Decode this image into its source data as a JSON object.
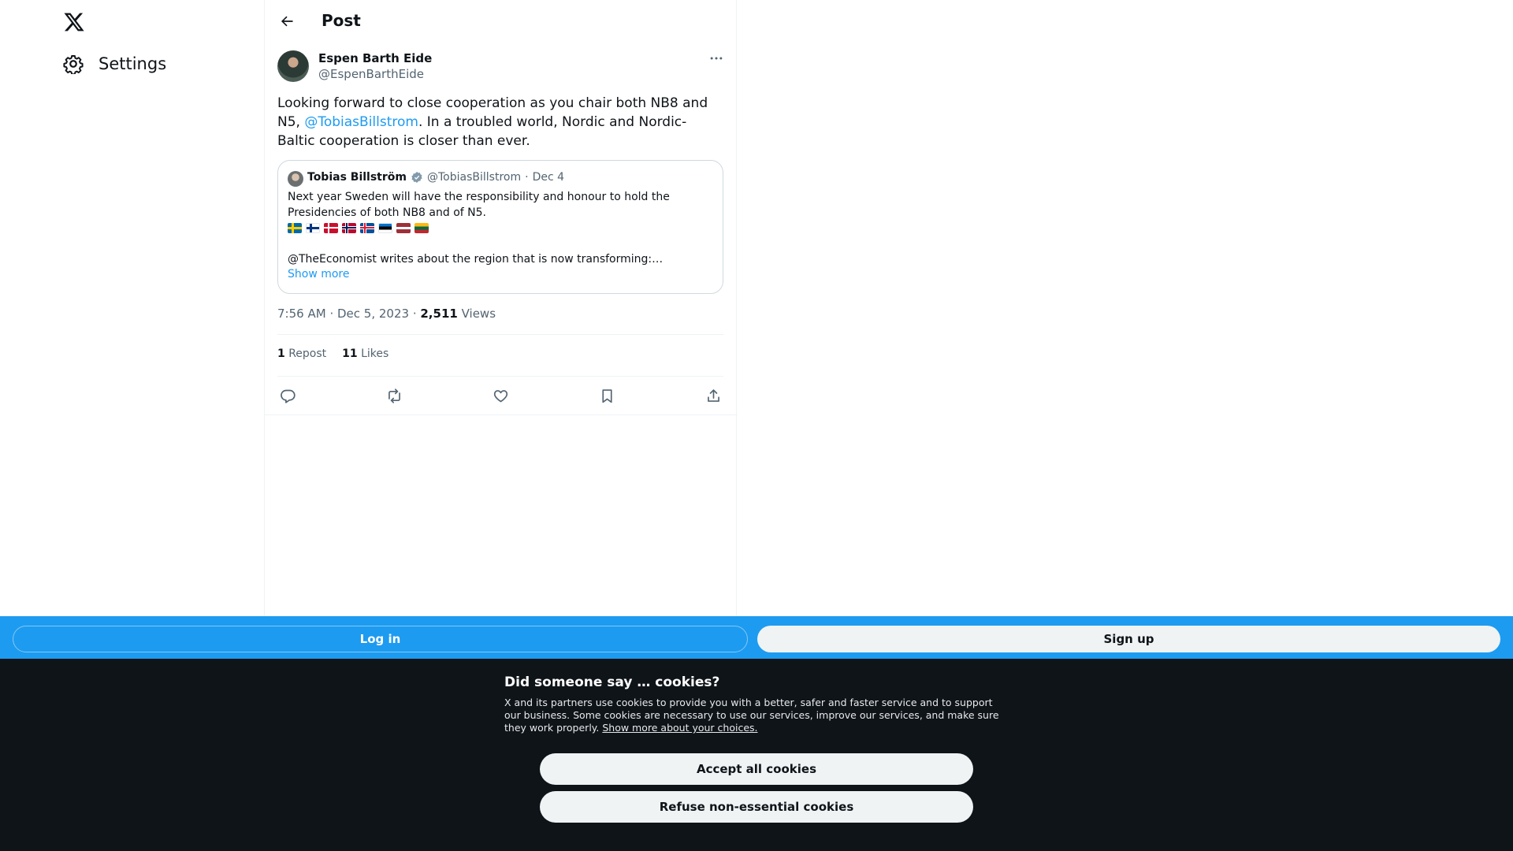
{
  "nav": {
    "logo_icon": "x-logo-icon",
    "settings_label": "Settings"
  },
  "header": {
    "title": "Post"
  },
  "post": {
    "author_name": "Espen Barth Eide",
    "author_handle": "@EspenBarthEide",
    "text_part1": "Looking forward to close cooperation as you chair both NB8 and N5, ",
    "mention": "@TobiasBillstrom",
    "text_part2": ". In a troubled world, Nordic and Nordic-Baltic cooperation is closer than ever.",
    "quote": {
      "author_name": "Tobias Billström",
      "author_handle": "@TobiasBillstrom",
      "separator": "·",
      "date": "Dec 4",
      "text": "Next year Sweden will have the responsibility and honour to hold the Presidencies of both NB8 and of N5.",
      "flags": [
        "Sweden",
        "Finland",
        "Denmark",
        "Norway",
        "Iceland",
        "Estonia",
        "Latvia",
        "Lithuania"
      ],
      "text2": "@TheEconomist writes about the region that is now transforming:…",
      "show_more": "Show more"
    },
    "time": "7:56 AM",
    "date": "Dec 5, 2023",
    "views_count": "2,511",
    "views_label": "Views",
    "reposts_count": "1",
    "reposts_label": "Repost",
    "likes_count": "11",
    "likes_label": "Likes"
  },
  "auth_bar": {
    "login_label": "Log in",
    "signup_label": "Sign up"
  },
  "cookies": {
    "title": "Did someone say … cookies?",
    "body": "X and its partners use cookies to provide you with a better, safer and faster service and to support our business. Some cookies are necessary to use our services, improve our services, and make sure they work properly. ",
    "link": "Show more about your choices.",
    "accept_label": "Accept all cookies",
    "refuse_label": "Refuse non-essential cookies"
  },
  "colors": {
    "accent": "#1d9bf0",
    "banner_bg": "#0f1419",
    "text": "#0f1419",
    "muted": "#536471"
  }
}
